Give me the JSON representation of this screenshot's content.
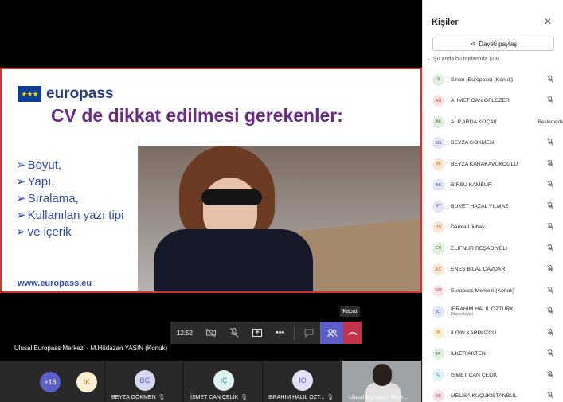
{
  "slide": {
    "logo_text": "europass",
    "title": "CV de dikkat edilmesi gerekenler:",
    "bullets": [
      "Boyut,",
      "Yapı,",
      "Sıralama,",
      "Kullanılan yazı tipi",
      "ve içerik"
    ],
    "url": "www.europass.eu"
  },
  "presenter_label": "Ulusal Europass Merkezi - M.Hüdazan YAŞIN (Konuk)",
  "controls": {
    "time": "12:52",
    "hangup_tooltip": "Kapat",
    "icons": [
      "camera-off-icon",
      "mic-off-icon",
      "share-screen-icon",
      "more-icon",
      "chat-icon",
      "people-icon",
      "hangup-icon"
    ]
  },
  "strip": {
    "overflow_count": "+18",
    "overflow_avatar": "IK",
    "tiles": [
      {
        "initials": "BG",
        "name": "BEYZA GÖKMEN",
        "avatar_bg": "#d6d9f2",
        "avatar_fg": "#5b5fc7"
      },
      {
        "initials": "İÇ",
        "name": "İSMET CAN ÇELİK",
        "avatar_bg": "#dff2f5",
        "avatar_fg": "#3a8fa1"
      },
      {
        "initials": "IO",
        "name": "IBRAHIM HALIL OZT...",
        "avatar_bg": "#e4e1f5",
        "avatar_fg": "#5b5fc7"
      }
    ],
    "camera_tile_name": "Ulusal Europass Merk..."
  },
  "panel": {
    "title": "Kişiler",
    "share_label": "Daveti paylaş",
    "section_label": "Şu anda bu toplantıda (23)",
    "participants": [
      {
        "initials": "S",
        "name": "Sinan (Europass) (Konuk)",
        "role": "",
        "status": "",
        "bg": "#e2efe0",
        "fg": "#3b7a3b"
      },
      {
        "initials": "AO",
        "name": "AHMET CAN OFLOZER",
        "role": "",
        "status": "",
        "bg": "#fbe1e1",
        "fg": "#b0413e"
      },
      {
        "initials": "AK",
        "name": "ALP ARDA KOÇAK",
        "role": "",
        "status": "Beklemede",
        "bg": "#e2efe0",
        "fg": "#3b7a3b"
      },
      {
        "initials": "BG",
        "name": "BEYZA GÖKMEN",
        "role": "",
        "status": "",
        "bg": "#e3e6f6",
        "fg": "#4a52a8"
      },
      {
        "initials": "BK",
        "name": "BEYZA KARAKAVUKOĞLU",
        "role": "",
        "status": "",
        "bg": "#fbe5d3",
        "fg": "#b4651d"
      },
      {
        "initials": "BK",
        "name": "BİRSU KAMBUR",
        "role": "",
        "status": "",
        "bg": "#e3e6f6",
        "fg": "#4a52a8"
      },
      {
        "initials": "BY",
        "name": "BUKET HAZAL YILMAZ",
        "role": "",
        "status": "",
        "bg": "#e3e6f6",
        "fg": "#4a52a8"
      },
      {
        "initials": "DU",
        "name": "Damla Ulubay",
        "role": "",
        "status": "",
        "bg": "#fbe5d3",
        "fg": "#b4651d"
      },
      {
        "initials": "ER",
        "name": "ELİFNUR REŞADİYELİ",
        "role": "",
        "status": "",
        "bg": "#e2efe0",
        "fg": "#3b7a3b"
      },
      {
        "initials": "EÇ",
        "name": "ENES BİLAL ÇAVDAR",
        "role": "",
        "status": "",
        "bg": "#fbe5d3",
        "fg": "#b4651d"
      },
      {
        "initials": "EM",
        "name": "Europass Merkezi (Konuk)",
        "role": "",
        "status": "",
        "bg": "#fce4e9",
        "fg": "#b03b5a"
      },
      {
        "initials": "IO",
        "name": "IBRAHIM HALIL OZTURK",
        "role": "Düzenleyici",
        "status": "",
        "bg": "#e3e6f6",
        "fg": "#4a52a8"
      },
      {
        "initials": "IK",
        "name": "ILGIN KARPUZCU",
        "role": "",
        "status": "",
        "bg": "#fdf1d3",
        "fg": "#a67812"
      },
      {
        "initials": "İA",
        "name": "İLKER AKTEN",
        "role": "",
        "status": "",
        "bg": "#e2efe0",
        "fg": "#3b7a3b"
      },
      {
        "initials": "İÇ",
        "name": "İSMET CAN ÇELİK",
        "role": "",
        "status": "",
        "bg": "#dff2f5",
        "fg": "#3a8fa1"
      },
      {
        "initials": "MK",
        "name": "MELISA KÜÇÜKİSTANBUL",
        "role": "",
        "status": "",
        "bg": "#fce4e9",
        "fg": "#b03b5a"
      }
    ]
  }
}
